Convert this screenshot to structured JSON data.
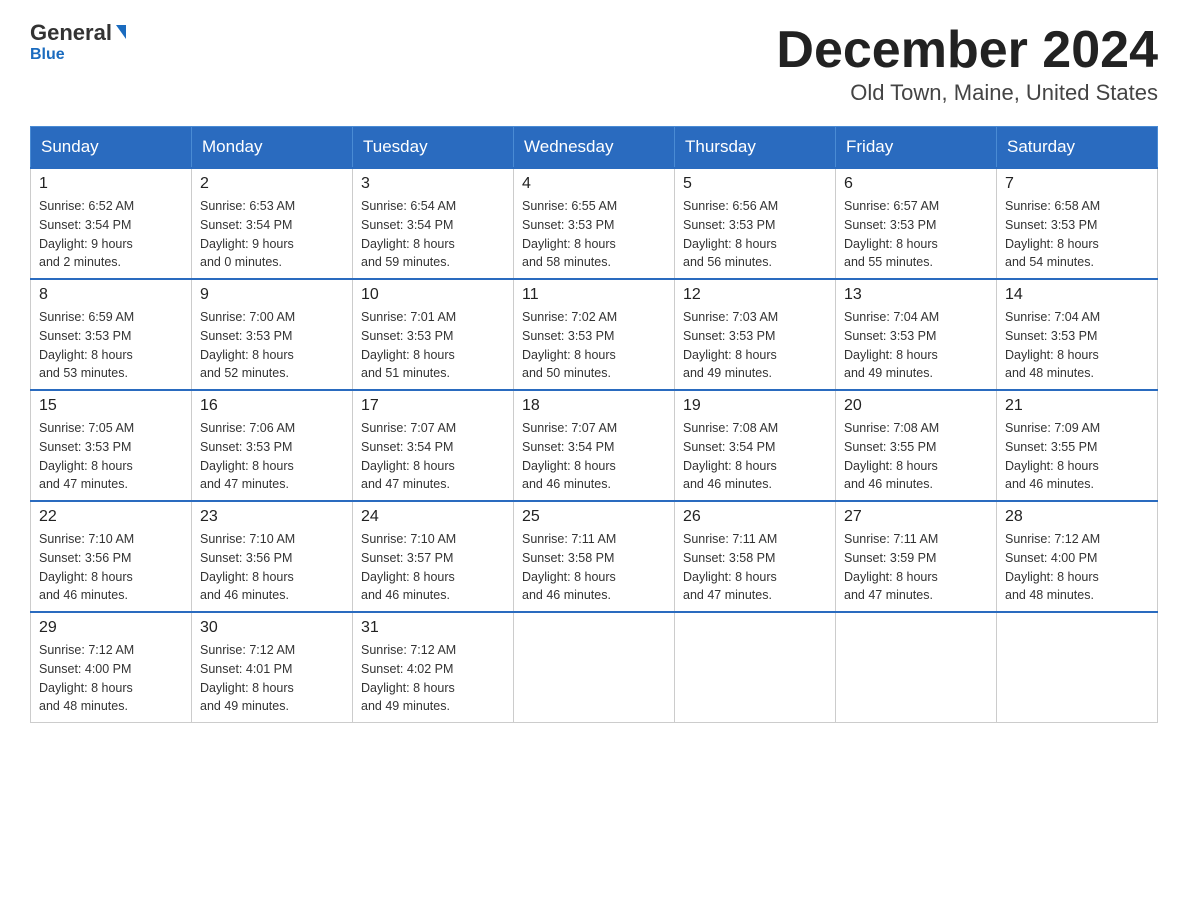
{
  "header": {
    "logo_general": "General",
    "logo_blue": "Blue",
    "month_title": "December 2024",
    "location": "Old Town, Maine, United States"
  },
  "weekdays": [
    "Sunday",
    "Monday",
    "Tuesday",
    "Wednesday",
    "Thursday",
    "Friday",
    "Saturday"
  ],
  "weeks": [
    [
      {
        "day": "1",
        "sunrise": "6:52 AM",
        "sunset": "3:54 PM",
        "daylight": "9 hours and 2 minutes."
      },
      {
        "day": "2",
        "sunrise": "6:53 AM",
        "sunset": "3:54 PM",
        "daylight": "9 hours and 0 minutes."
      },
      {
        "day": "3",
        "sunrise": "6:54 AM",
        "sunset": "3:54 PM",
        "daylight": "8 hours and 59 minutes."
      },
      {
        "day": "4",
        "sunrise": "6:55 AM",
        "sunset": "3:53 PM",
        "daylight": "8 hours and 58 minutes."
      },
      {
        "day": "5",
        "sunrise": "6:56 AM",
        "sunset": "3:53 PM",
        "daylight": "8 hours and 56 minutes."
      },
      {
        "day": "6",
        "sunrise": "6:57 AM",
        "sunset": "3:53 PM",
        "daylight": "8 hours and 55 minutes."
      },
      {
        "day": "7",
        "sunrise": "6:58 AM",
        "sunset": "3:53 PM",
        "daylight": "8 hours and 54 minutes."
      }
    ],
    [
      {
        "day": "8",
        "sunrise": "6:59 AM",
        "sunset": "3:53 PM",
        "daylight": "8 hours and 53 minutes."
      },
      {
        "day": "9",
        "sunrise": "7:00 AM",
        "sunset": "3:53 PM",
        "daylight": "8 hours and 52 minutes."
      },
      {
        "day": "10",
        "sunrise": "7:01 AM",
        "sunset": "3:53 PM",
        "daylight": "8 hours and 51 minutes."
      },
      {
        "day": "11",
        "sunrise": "7:02 AM",
        "sunset": "3:53 PM",
        "daylight": "8 hours and 50 minutes."
      },
      {
        "day": "12",
        "sunrise": "7:03 AM",
        "sunset": "3:53 PM",
        "daylight": "8 hours and 49 minutes."
      },
      {
        "day": "13",
        "sunrise": "7:04 AM",
        "sunset": "3:53 PM",
        "daylight": "8 hours and 49 minutes."
      },
      {
        "day": "14",
        "sunrise": "7:04 AM",
        "sunset": "3:53 PM",
        "daylight": "8 hours and 48 minutes."
      }
    ],
    [
      {
        "day": "15",
        "sunrise": "7:05 AM",
        "sunset": "3:53 PM",
        "daylight": "8 hours and 47 minutes."
      },
      {
        "day": "16",
        "sunrise": "7:06 AM",
        "sunset": "3:53 PM",
        "daylight": "8 hours and 47 minutes."
      },
      {
        "day": "17",
        "sunrise": "7:07 AM",
        "sunset": "3:54 PM",
        "daylight": "8 hours and 47 minutes."
      },
      {
        "day": "18",
        "sunrise": "7:07 AM",
        "sunset": "3:54 PM",
        "daylight": "8 hours and 46 minutes."
      },
      {
        "day": "19",
        "sunrise": "7:08 AM",
        "sunset": "3:54 PM",
        "daylight": "8 hours and 46 minutes."
      },
      {
        "day": "20",
        "sunrise": "7:08 AM",
        "sunset": "3:55 PM",
        "daylight": "8 hours and 46 minutes."
      },
      {
        "day": "21",
        "sunrise": "7:09 AM",
        "sunset": "3:55 PM",
        "daylight": "8 hours and 46 minutes."
      }
    ],
    [
      {
        "day": "22",
        "sunrise": "7:10 AM",
        "sunset": "3:56 PM",
        "daylight": "8 hours and 46 minutes."
      },
      {
        "day": "23",
        "sunrise": "7:10 AM",
        "sunset": "3:56 PM",
        "daylight": "8 hours and 46 minutes."
      },
      {
        "day": "24",
        "sunrise": "7:10 AM",
        "sunset": "3:57 PM",
        "daylight": "8 hours and 46 minutes."
      },
      {
        "day": "25",
        "sunrise": "7:11 AM",
        "sunset": "3:58 PM",
        "daylight": "8 hours and 46 minutes."
      },
      {
        "day": "26",
        "sunrise": "7:11 AM",
        "sunset": "3:58 PM",
        "daylight": "8 hours and 47 minutes."
      },
      {
        "day": "27",
        "sunrise": "7:11 AM",
        "sunset": "3:59 PM",
        "daylight": "8 hours and 47 minutes."
      },
      {
        "day": "28",
        "sunrise": "7:12 AM",
        "sunset": "4:00 PM",
        "daylight": "8 hours and 48 minutes."
      }
    ],
    [
      {
        "day": "29",
        "sunrise": "7:12 AM",
        "sunset": "4:00 PM",
        "daylight": "8 hours and 48 minutes."
      },
      {
        "day": "30",
        "sunrise": "7:12 AM",
        "sunset": "4:01 PM",
        "daylight": "8 hours and 49 minutes."
      },
      {
        "day": "31",
        "sunrise": "7:12 AM",
        "sunset": "4:02 PM",
        "daylight": "8 hours and 49 minutes."
      },
      null,
      null,
      null,
      null
    ]
  ],
  "labels": {
    "sunrise_prefix": "Sunrise: ",
    "sunset_prefix": "Sunset: ",
    "daylight_prefix": "Daylight: "
  }
}
